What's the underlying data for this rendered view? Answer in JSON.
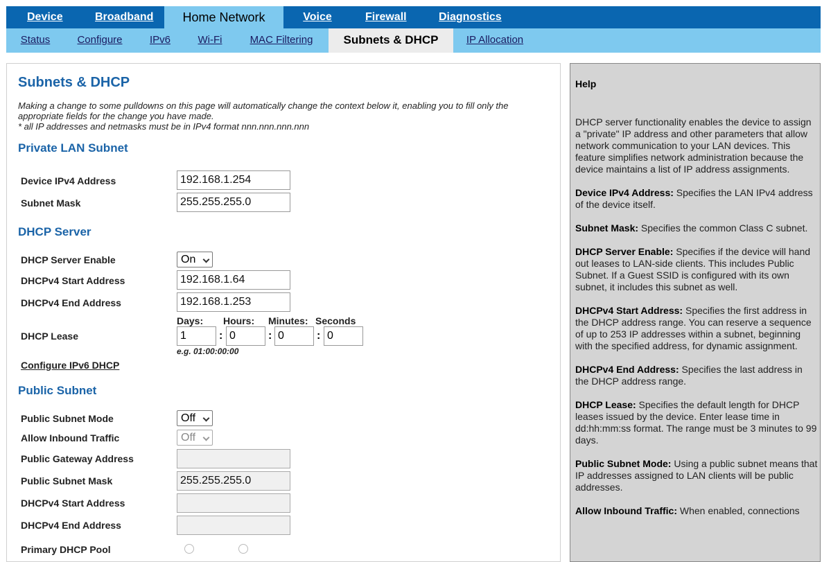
{
  "top_nav": [
    {
      "label": "Device",
      "active": false
    },
    {
      "label": "Broadband",
      "active": false
    },
    {
      "label": "Home Network",
      "active": true
    },
    {
      "label": "Voice",
      "active": false
    },
    {
      "label": "Firewall",
      "active": false
    },
    {
      "label": "Diagnostics",
      "active": false
    }
  ],
  "sub_nav": [
    {
      "label": "Status",
      "active": false
    },
    {
      "label": "Configure",
      "active": false
    },
    {
      "label": "IPv6",
      "active": false
    },
    {
      "label": "Wi-Fi",
      "active": false
    },
    {
      "label": "MAC Filtering",
      "active": false
    },
    {
      "label": "Subnets & DHCP",
      "active": true
    },
    {
      "label": "IP Allocation",
      "active": false
    }
  ],
  "page": {
    "title": "Subnets & DHCP",
    "note_line1": "Making a change to some pulldowns on this page will automatically change the context below it, enabling you to fill only the appropriate fields for the change you have made.",
    "note_line2": "* all IP addresses and netmasks must be in IPv4 format nnn.nnn.nnn.nnn"
  },
  "private_lan": {
    "heading": "Private LAN Subnet",
    "device_ipv4_label": "Device IPv4 Address",
    "device_ipv4_value": "192.168.1.254",
    "subnet_mask_label": "Subnet Mask",
    "subnet_mask_value": "255.255.255.0"
  },
  "dhcp_server": {
    "heading": "DHCP Server",
    "enable_label": "DHCP Server Enable",
    "enable_value": "On",
    "start_label": "DHCPv4 Start Address",
    "start_value": "192.168.1.64",
    "end_label": "DHCPv4 End Address",
    "end_value": "192.168.1.253",
    "lease_label": "DHCP Lease",
    "lease_days_label": "Days:",
    "lease_hours_label": "Hours:",
    "lease_minutes_label": "Minutes:",
    "lease_seconds_label": "Seconds",
    "lease_days": "1",
    "lease_hours": "0",
    "lease_minutes": "0",
    "lease_seconds": "0",
    "colon": ":",
    "lease_example": "e.g. 01:00:00:00",
    "configure_ipv6_link": "Configure IPv6 DHCP"
  },
  "public_subnet": {
    "heading": "Public Subnet",
    "mode_label": "Public Subnet Mode",
    "mode_value": "Off",
    "inbound_label": "Allow Inbound Traffic",
    "inbound_value": "Off",
    "gateway_label": "Public Gateway Address",
    "gateway_value": "",
    "mask_label": "Public Subnet Mask",
    "mask_value": "255.255.255.0",
    "start_label": "DHCPv4 Start Address",
    "start_value": "",
    "end_label": "DHCPv4 End Address",
    "end_value": "",
    "primary_label": "Primary DHCP Pool"
  },
  "help": {
    "title": "Help",
    "intro": "DHCP server functionality enables the device to assign a \"private\" IP address and other parameters that allow network communication to your LAN devices. This feature simplifies network administration because the device maintains a list of IP address assignments.",
    "items": [
      {
        "term": "Device IPv4 Address:",
        "text": " Specifies the LAN IPv4 address of the device itself."
      },
      {
        "term": "Subnet Mask:",
        "text": " Specifies the common Class C subnet."
      },
      {
        "term": "DHCP Server Enable:",
        "text": " Specifies if the device will hand out leases to LAN-side clients. This includes Public Subnet. If a Guest SSID is configured with its own subnet, it includes this subnet as well."
      },
      {
        "term": "DHCPv4 Start Address:",
        "text": " Specifies the first address in the DHCP address range. You can reserve a sequence of up to 253 IP addresses within a subnet, beginning with the specified address, for dynamic assignment."
      },
      {
        "term": "DHCPv4 End Address:",
        "text": " Specifies the last address in the DHCP address range."
      },
      {
        "term": "DHCP Lease:",
        "text": " Specifies the default length for DHCP leases issued by the device. Enter lease time in dd:hh:mm:ss format. The range must be 3 minutes to 99 days."
      },
      {
        "term": "Public Subnet Mode:",
        "text": " Using a public subnet means that IP addresses assigned to LAN clients will be public addresses."
      },
      {
        "term": "Allow Inbound Traffic:",
        "text": " When enabled, connections"
      }
    ]
  }
}
